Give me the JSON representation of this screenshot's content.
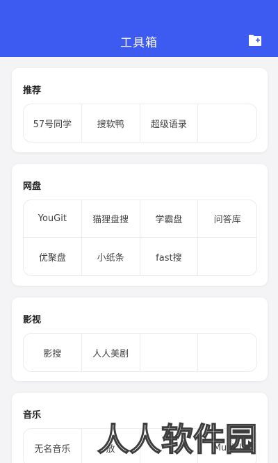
{
  "header": {
    "title": "工具箱",
    "action_icon": "folder-add-icon",
    "background": "#3d5af1"
  },
  "sections": [
    {
      "title": "推荐",
      "items": [
        "57号同学",
        "搜软鸭",
        "超级语录",
        ""
      ]
    },
    {
      "title": "网盘",
      "items": [
        "YouGit",
        "猫狸盘搜",
        "学霸盘",
        "问答库",
        "优聚盘",
        "小纸条",
        "fast搜",
        ""
      ]
    },
    {
      "title": "影视",
      "items": [
        "影搜",
        "人人美剧",
        "",
        ""
      ]
    },
    {
      "title": "音乐",
      "items": [
        "无名音乐",
        "放",
        "",
        "Musicl"
      ]
    }
  ],
  "watermark": "人人软件园"
}
